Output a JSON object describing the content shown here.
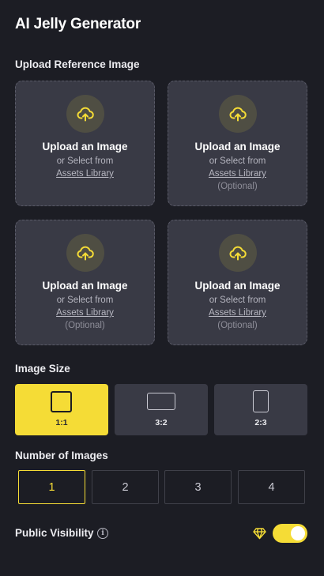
{
  "app": {
    "title": "AI Jelly Generator"
  },
  "upload_section": {
    "label": "Upload Reference Image",
    "boxes": [
      {
        "title": "Upload an Image",
        "subtitle": "or Select from",
        "link": "Assets Library",
        "optional": ""
      },
      {
        "title": "Upload an Image",
        "subtitle": "or Select from",
        "link": "Assets Library",
        "optional": "(Optional)"
      },
      {
        "title": "Upload an Image",
        "subtitle": "or Select from",
        "link": "Assets Library",
        "optional": "(Optional)"
      },
      {
        "title": "Upload an Image",
        "subtitle": "or Select from",
        "link": "Assets Library",
        "optional": "(Optional)"
      }
    ]
  },
  "image_size": {
    "label": "Image Size",
    "selected": "1:1",
    "options": [
      {
        "label": "1:1",
        "icon": "square-ratio-icon"
      },
      {
        "label": "3:2",
        "icon": "landscape-ratio-icon"
      },
      {
        "label": "2:3",
        "icon": "portrait-ratio-icon"
      }
    ]
  },
  "number_of_images": {
    "label": "Number of Images",
    "selected": "1",
    "options": [
      "1",
      "2",
      "3",
      "4"
    ]
  },
  "public_visibility": {
    "label": "Public Visibility",
    "info_icon": "info-icon",
    "premium_icon": "diamond-icon",
    "enabled": true
  },
  "colors": {
    "background": "#1c1d24",
    "panel": "#393a45",
    "accent": "#f5dc36",
    "upload_icon_bg": "#4f4e43"
  }
}
